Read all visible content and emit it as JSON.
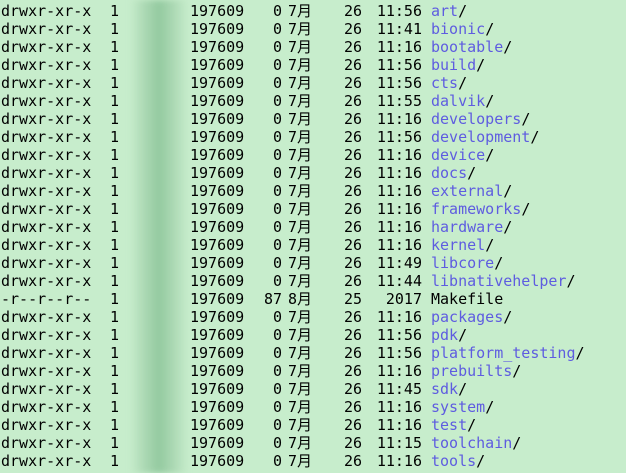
{
  "window": {
    "background": "#c7edcc",
    "dir_color": "#5e5ce0"
  },
  "listing": [
    {
      "perms": "drwxr-xr-x",
      "links": "1",
      "size": "197609",
      "x": "0",
      "month": "7月",
      "day": "26",
      "time": "11:56",
      "name": "art",
      "suffix": "/",
      "type": "dir"
    },
    {
      "perms": "drwxr-xr-x",
      "links": "1",
      "size": "197609",
      "x": "0",
      "month": "7月",
      "day": "26",
      "time": "11:41",
      "name": "bionic",
      "suffix": "/",
      "type": "dir"
    },
    {
      "perms": "drwxr-xr-x",
      "links": "1",
      "size": "197609",
      "x": "0",
      "month": "7月",
      "day": "26",
      "time": "11:16",
      "name": "bootable",
      "suffix": "/",
      "type": "dir"
    },
    {
      "perms": "drwxr-xr-x",
      "links": "1",
      "size": "197609",
      "x": "0",
      "month": "7月",
      "day": "26",
      "time": "11:56",
      "name": "build",
      "suffix": "/",
      "type": "dir"
    },
    {
      "perms": "drwxr-xr-x",
      "links": "1",
      "size": "197609",
      "x": "0",
      "month": "7月",
      "day": "26",
      "time": "11:56",
      "name": "cts",
      "suffix": "/",
      "type": "dir"
    },
    {
      "perms": "drwxr-xr-x",
      "links": "1",
      "size": "197609",
      "x": "0",
      "month": "7月",
      "day": "26",
      "time": "11:55",
      "name": "dalvik",
      "suffix": "/",
      "type": "dir"
    },
    {
      "perms": "drwxr-xr-x",
      "links": "1",
      "size": "197609",
      "x": "0",
      "month": "7月",
      "day": "26",
      "time": "11:16",
      "name": "developers",
      "suffix": "/",
      "type": "dir"
    },
    {
      "perms": "drwxr-xr-x",
      "links": "1",
      "size": "197609",
      "x": "0",
      "month": "7月",
      "day": "26",
      "time": "11:56",
      "name": "development",
      "suffix": "/",
      "type": "dir"
    },
    {
      "perms": "drwxr-xr-x",
      "links": "1",
      "size": "197609",
      "x": "0",
      "month": "7月",
      "day": "26",
      "time": "11:16",
      "name": "device",
      "suffix": "/",
      "type": "dir"
    },
    {
      "perms": "drwxr-xr-x",
      "links": "1",
      "size": "197609",
      "x": "0",
      "month": "7月",
      "day": "26",
      "time": "11:16",
      "name": "docs",
      "suffix": "/",
      "type": "dir"
    },
    {
      "perms": "drwxr-xr-x",
      "links": "1",
      "size": "197609",
      "x": "0",
      "month": "7月",
      "day": "26",
      "time": "11:16",
      "name": "external",
      "suffix": "/",
      "type": "dir"
    },
    {
      "perms": "drwxr-xr-x",
      "links": "1",
      "size": "197609",
      "x": "0",
      "month": "7月",
      "day": "26",
      "time": "11:16",
      "name": "frameworks",
      "suffix": "/",
      "type": "dir"
    },
    {
      "perms": "drwxr-xr-x",
      "links": "1",
      "size": "197609",
      "x": "0",
      "month": "7月",
      "day": "26",
      "time": "11:16",
      "name": "hardware",
      "suffix": "/",
      "type": "dir"
    },
    {
      "perms": "drwxr-xr-x",
      "links": "1",
      "size": "197609",
      "x": "0",
      "month": "7月",
      "day": "26",
      "time": "11:16",
      "name": "kernel",
      "suffix": "/",
      "type": "dir"
    },
    {
      "perms": "drwxr-xr-x",
      "links": "1",
      "size": "197609",
      "x": "0",
      "month": "7月",
      "day": "26",
      "time": "11:49",
      "name": "libcore",
      "suffix": "/",
      "type": "dir"
    },
    {
      "perms": "drwxr-xr-x",
      "links": "1",
      "size": "197609",
      "x": "0",
      "month": "7月",
      "day": "26",
      "time": "11:44",
      "name": "libnativehelper",
      "suffix": "/",
      "type": "dir"
    },
    {
      "perms": "-r--r--r--",
      "links": "1",
      "size": "197609",
      "x": "87",
      "month": "8月",
      "day": "25",
      "time": "2017",
      "name": "Makefile",
      "suffix": "",
      "type": "file"
    },
    {
      "perms": "drwxr-xr-x",
      "links": "1",
      "size": "197609",
      "x": "0",
      "month": "7月",
      "day": "26",
      "time": "11:16",
      "name": "packages",
      "suffix": "/",
      "type": "dir"
    },
    {
      "perms": "drwxr-xr-x",
      "links": "1",
      "size": "197609",
      "x": "0",
      "month": "7月",
      "day": "26",
      "time": "11:56",
      "name": "pdk",
      "suffix": "/",
      "type": "dir"
    },
    {
      "perms": "drwxr-xr-x",
      "links": "1",
      "size": "197609",
      "x": "0",
      "month": "7月",
      "day": "26",
      "time": "11:56",
      "name": "platform_testing",
      "suffix": "/",
      "type": "dir"
    },
    {
      "perms": "drwxr-xr-x",
      "links": "1",
      "size": "197609",
      "x": "0",
      "month": "7月",
      "day": "26",
      "time": "11:16",
      "name": "prebuilts",
      "suffix": "/",
      "type": "dir"
    },
    {
      "perms": "drwxr-xr-x",
      "links": "1",
      "size": "197609",
      "x": "0",
      "month": "7月",
      "day": "26",
      "time": "11:45",
      "name": "sdk",
      "suffix": "/",
      "type": "dir"
    },
    {
      "perms": "drwxr-xr-x",
      "links": "1",
      "size": "197609",
      "x": "0",
      "month": "7月",
      "day": "26",
      "time": "11:16",
      "name": "system",
      "suffix": "/",
      "type": "dir"
    },
    {
      "perms": "drwxr-xr-x",
      "links": "1",
      "size": "197609",
      "x": "0",
      "month": "7月",
      "day": "26",
      "time": "11:16",
      "name": "test",
      "suffix": "/",
      "type": "dir"
    },
    {
      "perms": "drwxr-xr-x",
      "links": "1",
      "size": "197609",
      "x": "0",
      "month": "7月",
      "day": "26",
      "time": "11:15",
      "name": "toolchain",
      "suffix": "/",
      "type": "dir"
    },
    {
      "perms": "drwxr-xr-x",
      "links": "1",
      "size": "197609",
      "x": "0",
      "month": "7月",
      "day": "26",
      "time": "11:16",
      "name": "tools",
      "suffix": "/",
      "type": "dir"
    }
  ]
}
